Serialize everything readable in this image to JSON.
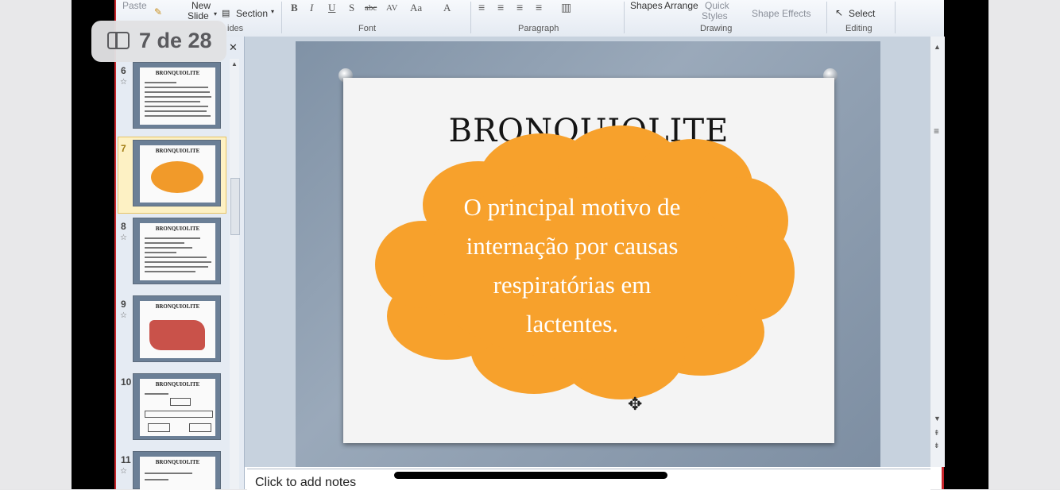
{
  "overlay": {
    "page_indicator": "7 de 28"
  },
  "ribbon": {
    "paste": "Paste",
    "new_slide": "New",
    "new_slide_2": "Slide",
    "section": "Section",
    "shapes": "Shapes",
    "arrange": "Arrange",
    "quick_styles": "Quick",
    "quick_styles_2": "Styles",
    "shape_effects": "Shape Effects",
    "select": "Select",
    "groups": {
      "slides": "ides",
      "font": "Font",
      "paragraph": "Paragraph",
      "drawing": "Drawing",
      "editing": "Editing"
    }
  },
  "slides_panel": {
    "thumbnails": [
      {
        "number": "6",
        "title": "BRONQUIOLITE"
      },
      {
        "number": "7",
        "title": "BRONQUIOLITE",
        "selected": true
      },
      {
        "number": "8",
        "title": "BRONQUIOLITE"
      },
      {
        "number": "9",
        "title": "BRONQUIOLITE"
      },
      {
        "number": "10",
        "title": "BRONQUIOLITE"
      },
      {
        "number": "11",
        "title": "BRONQUIOLITE"
      }
    ]
  },
  "slide": {
    "title": "BRONQUIOLITE",
    "cloud_lines": [
      "O principal motivo de",
      "internação por causas",
      "respiratórias em",
      "lactentes."
    ],
    "cloud_color": "#f7a12c"
  },
  "notes": {
    "placeholder": "Click to add notes"
  }
}
